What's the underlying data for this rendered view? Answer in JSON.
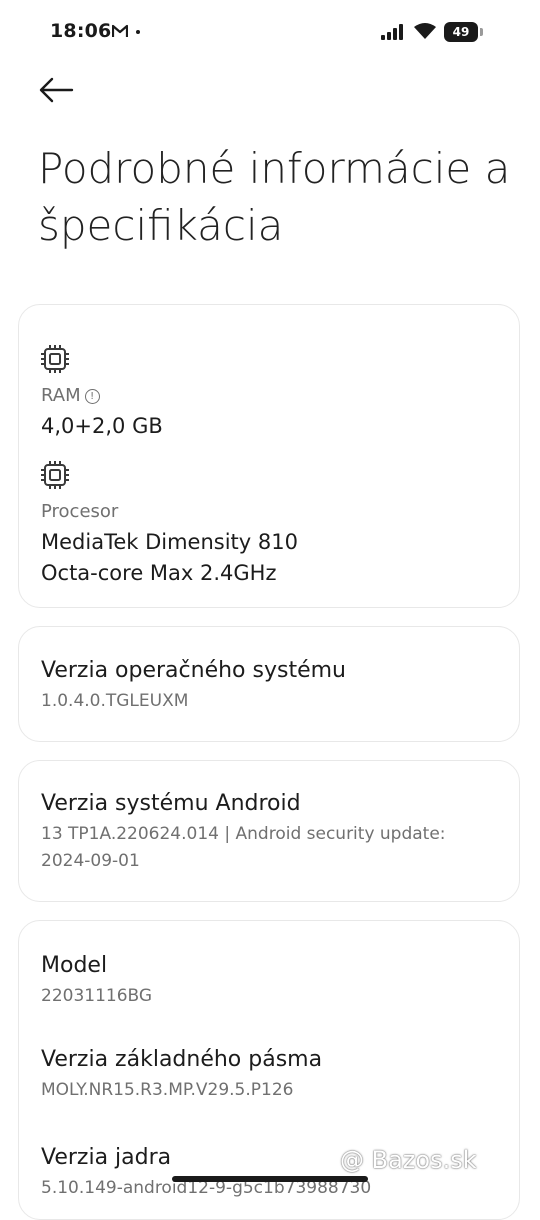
{
  "status_bar": {
    "time": "18:06",
    "battery": "49",
    "notification_icons": [
      "gmail-icon",
      "dot-icon"
    ],
    "system_icons": [
      "signal-icon",
      "wifi-icon",
      "battery-icon"
    ]
  },
  "header": {
    "back_icon": "arrow-left-icon",
    "title": "Podrobné informácie a špecifikácia"
  },
  "specs_card": {
    "ram": {
      "icon": "chip-icon",
      "label": "RAM",
      "value": "4,0+2,0 GB",
      "info_icon": "info-icon"
    },
    "processor": {
      "icon": "chip-icon",
      "label": "Procesor",
      "value_line1": "MediaTek Dimensity 810",
      "value_line2": "Octa-core Max 2.4GHz"
    }
  },
  "os_card": {
    "title": "Verzia operačného systému",
    "value": "1.0.4.0.TGLEUXM"
  },
  "android_card": {
    "title": "Verzia systému Android",
    "value_line1": "13 TP1A.220624.014 | Android security update:",
    "value_line2": "2024-09-01"
  },
  "device_card": {
    "items": [
      {
        "title": "Model",
        "value": "22031116BG"
      },
      {
        "title": "Verzia základného pásma",
        "value": "MOLY.NR15.R3.MP.V29.5.P126"
      },
      {
        "title": "Verzia jadra",
        "value": "5.10.149-android12-9-g5c1b73988730"
      }
    ]
  },
  "watermark": "@ Bazos.sk",
  "colors": {
    "background": "#ffffff",
    "card_border": "#e8e8e8",
    "secondary_text": "#707070",
    "primary_text": "#1c1c1c"
  }
}
